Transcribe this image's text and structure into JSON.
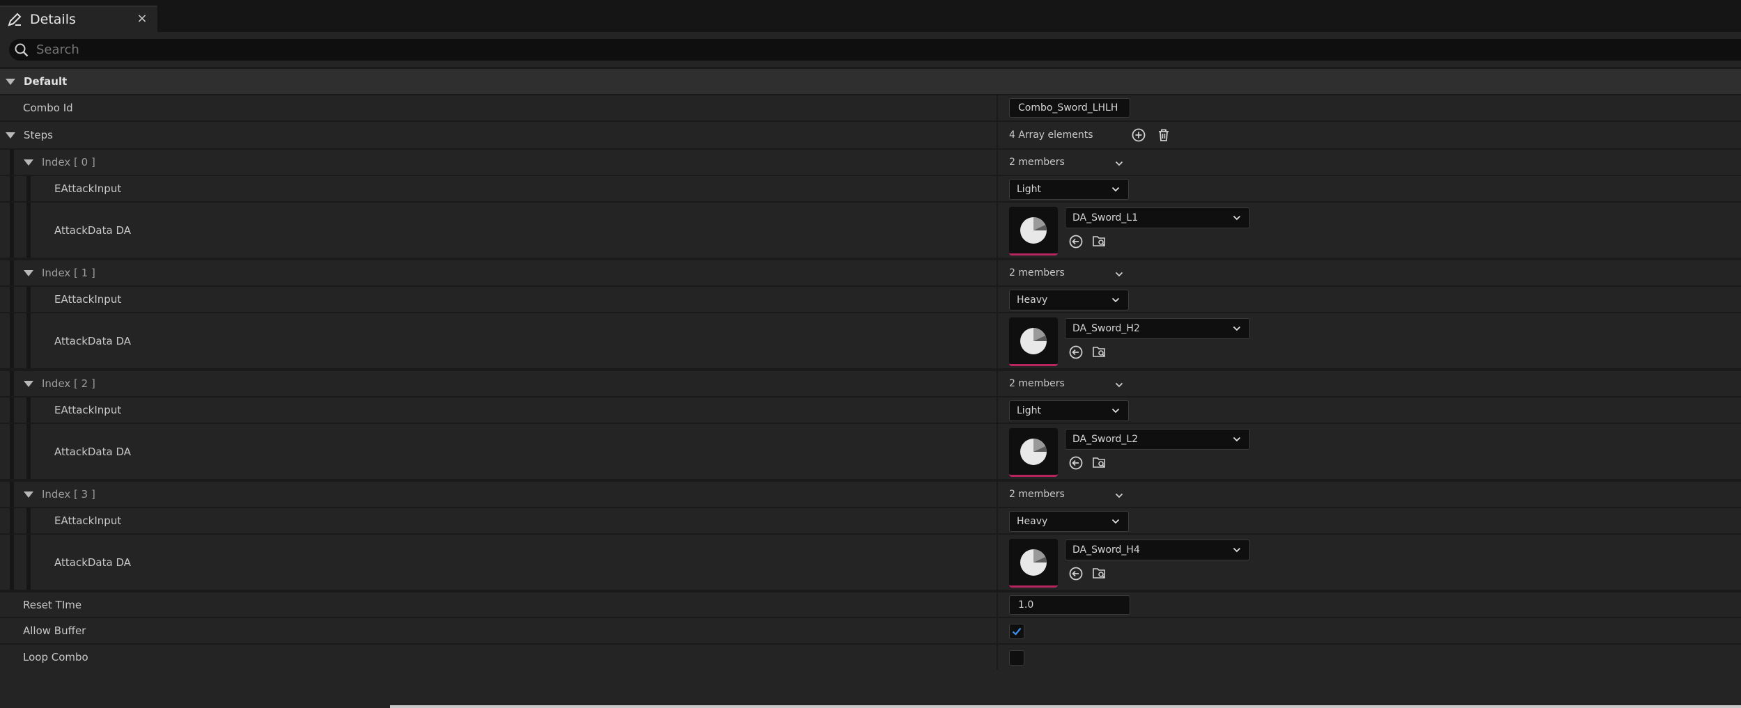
{
  "tab": {
    "title": "Details",
    "close": "×"
  },
  "search": {
    "placeholder": "Search"
  },
  "category": {
    "label": "Default"
  },
  "combo_id": {
    "label": "Combo Id",
    "value": "Combo_Sword_LHLH"
  },
  "steps": {
    "label": "Steps",
    "count_text": "4 Array elements",
    "items": [
      {
        "index_label": "Index [ 0 ]",
        "members": "2 members",
        "input_label": "EAttackInput",
        "input_value": "Light",
        "data_label": "AttackData DA",
        "asset": "DA_Sword_L1"
      },
      {
        "index_label": "Index [ 1 ]",
        "members": "2 members",
        "input_label": "EAttackInput",
        "input_value": "Heavy",
        "data_label": "AttackData DA",
        "asset": "DA_Sword_H2"
      },
      {
        "index_label": "Index [ 2 ]",
        "members": "2 members",
        "input_label": "EAttackInput",
        "input_value": "Light",
        "data_label": "AttackData DA",
        "asset": "DA_Sword_L2"
      },
      {
        "index_label": "Index [ 3 ]",
        "members": "2 members",
        "input_label": "EAttackInput",
        "input_value": "Heavy",
        "data_label": "AttackData DA",
        "asset": "DA_Sword_H4"
      }
    ]
  },
  "reset_time": {
    "label": "Reset TIme",
    "value": "1.0"
  },
  "allow_buffer": {
    "label": "Allow Buffer",
    "checked": true
  },
  "loop_combo": {
    "label": "Loop Combo",
    "checked": false
  },
  "colors": {
    "accent_asset": "#b5265e",
    "check": "#3d8ee8"
  }
}
